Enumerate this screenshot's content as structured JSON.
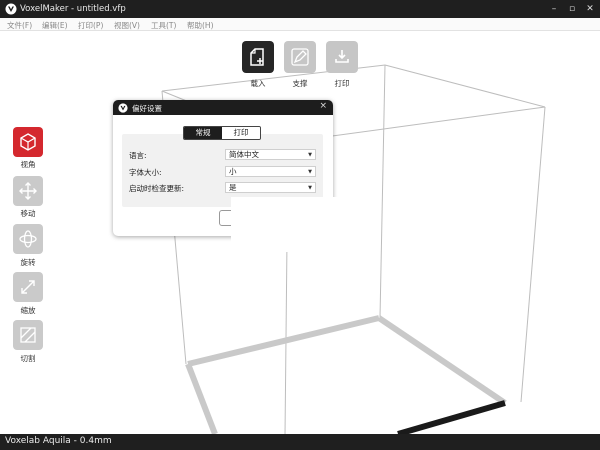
{
  "window": {
    "title": "VoxelMaker - untitled.vfp",
    "minimize_glyph": "–",
    "maximize_glyph": "▫",
    "close_glyph": "✕"
  },
  "menu": {
    "items": [
      "文件(F)",
      "编辑(E)",
      "打印(P)",
      "视图(V)",
      "工具(T)",
      "帮助(H)"
    ]
  },
  "toolbar": {
    "load_label": "载入",
    "support_label": "支撑",
    "print_label": "打印"
  },
  "sidebar": {
    "view_label": "视角",
    "move_label": "移动",
    "rotate_label": "旋转",
    "scale_label": "缩放",
    "cut_label": "切割"
  },
  "dialog": {
    "title": "偏好设置",
    "close_glyph": "×",
    "tabs": [
      "常规",
      "打印"
    ],
    "settings": [
      {
        "label": "语言:",
        "value": "简体中文"
      },
      {
        "label": "字体大小:",
        "value": "小"
      },
      {
        "label": "启动时检查更新:",
        "value": "是"
      }
    ]
  },
  "status": {
    "printer": "Voxelab Aquila - 0.4mm"
  },
  "colors": {
    "accent": "#d4282e",
    "dark": "#1f1f1f",
    "icon_inactive": "#cacaca"
  },
  "icons": {
    "app": "voxelmaker-logo-icon",
    "load": "load-file-icon",
    "support": "support-pencil-icon",
    "print": "print-icon",
    "view": "view-cube-icon",
    "move": "move-arrows-icon",
    "rotate": "rotate-icon",
    "scale": "scale-icon",
    "cut": "cut-icon"
  }
}
